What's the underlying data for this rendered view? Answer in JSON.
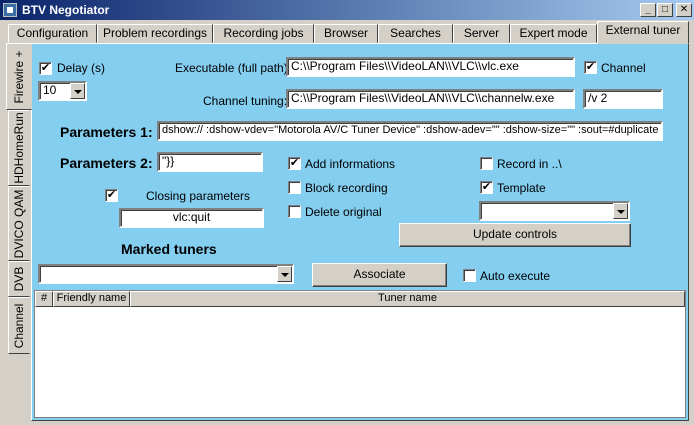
{
  "window": {
    "title": "BTV Negotiator",
    "controls": {
      "minimize": "_",
      "maximize": "□",
      "close": "✕"
    }
  },
  "tabs": [
    {
      "label": "Configuration"
    },
    {
      "label": "Problem recordings"
    },
    {
      "label": "Recording jobs"
    },
    {
      "label": "Browser"
    },
    {
      "label": "Searches"
    },
    {
      "label": "Server"
    },
    {
      "label": "Expert mode"
    },
    {
      "label": "External tuner",
      "active": true
    }
  ],
  "side_tabs": [
    {
      "label": "Firewire +",
      "active": true
    },
    {
      "label": "HDHomeRun"
    },
    {
      "label": "DVICO QAM"
    },
    {
      "label": "DVB"
    },
    {
      "label": "Channel"
    }
  ],
  "form": {
    "delay": {
      "label": "Delay (s)",
      "checked": true,
      "value": "10"
    },
    "executable": {
      "label": "Executable (full path):",
      "value": "C:\\\\Program Files\\\\VideoLAN\\\\VLC\\\\vlc.exe"
    },
    "channel": {
      "label": "Channel",
      "checked": true
    },
    "channel_tuning": {
      "label": "Channel tuning:",
      "value": "C:\\\\Program Files\\\\VideoLAN\\\\VLC\\\\channelw.exe",
      "arg": "/v 2"
    },
    "parameters1": {
      "label": "Parameters 1:",
      "value": "dshow:// :dshow-vdev=\"Motorola AV/C Tuner Device\" :dshow-adev=\"\" :dshow-size=\"\" :sout=#duplicate"
    },
    "parameters2": {
      "label": "Parameters 2:",
      "value": "\"}}"
    },
    "add_informations": {
      "label": "Add informations",
      "checked": true
    },
    "record_in": {
      "label": "Record in ..\\",
      "checked": false
    },
    "block_recording": {
      "label": "Block recording",
      "checked": false
    },
    "template": {
      "label": "Template",
      "checked": true,
      "value": ""
    },
    "delete_original": {
      "label": "Delete original",
      "checked": false
    },
    "closing": {
      "label": "Closing parameters",
      "checked": true,
      "value": "vlc:quit"
    },
    "update_controls": "Update controls",
    "marked_tuners": {
      "label": "Marked tuners",
      "value": ""
    },
    "associate": "Associate",
    "auto_execute": {
      "label": "Auto execute",
      "checked": false
    }
  },
  "grid": {
    "columns": [
      "#",
      "Friendly name",
      "Tuner name"
    ],
    "rows": []
  }
}
